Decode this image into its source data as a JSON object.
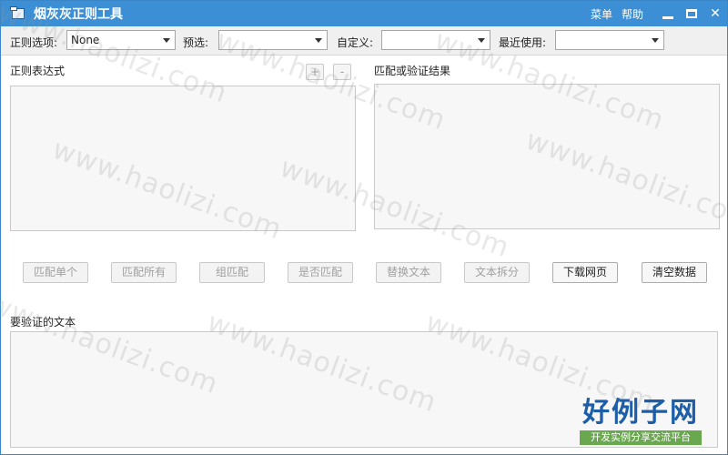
{
  "window": {
    "title": "烟灰灰正则工具",
    "menu_label": "菜单",
    "help_label": "帮助",
    "minimize_icon": "minimize-icon",
    "maximize_icon": "maximize-icon",
    "close_glyph": "✕"
  },
  "toolbar": {
    "regex_options_label": "正则选项:",
    "regex_options_value": "None",
    "preset_label": "预选:",
    "preset_value": "",
    "custom_label": "自定义:",
    "custom_value": "",
    "recent_label": "最近使用:",
    "recent_value": ""
  },
  "regex_section": {
    "label": "正则表达式",
    "add_button": "+",
    "remove_button": "-",
    "value": ""
  },
  "result_section": {
    "label": "匹配或验证结果",
    "value": ""
  },
  "actions": {
    "match_single": "匹配单个",
    "match_all": "匹配所有",
    "group_match": "组匹配",
    "is_match": "是否匹配",
    "replace_text": "替换文本",
    "split_text": "文本拆分",
    "download_page": "下载网页",
    "clear_data": "清空数据"
  },
  "input_section": {
    "label": "要验证的文本",
    "value": ""
  },
  "watermark": {
    "text": "www.haolizi.com"
  },
  "logo": {
    "main": "好例子网",
    "sub": "开发实例分享交流平台"
  },
  "colors": {
    "titlebar": "#3c8fd4",
    "logo_blue": "#1d5ea8",
    "logo_green": "#6aa84f"
  }
}
